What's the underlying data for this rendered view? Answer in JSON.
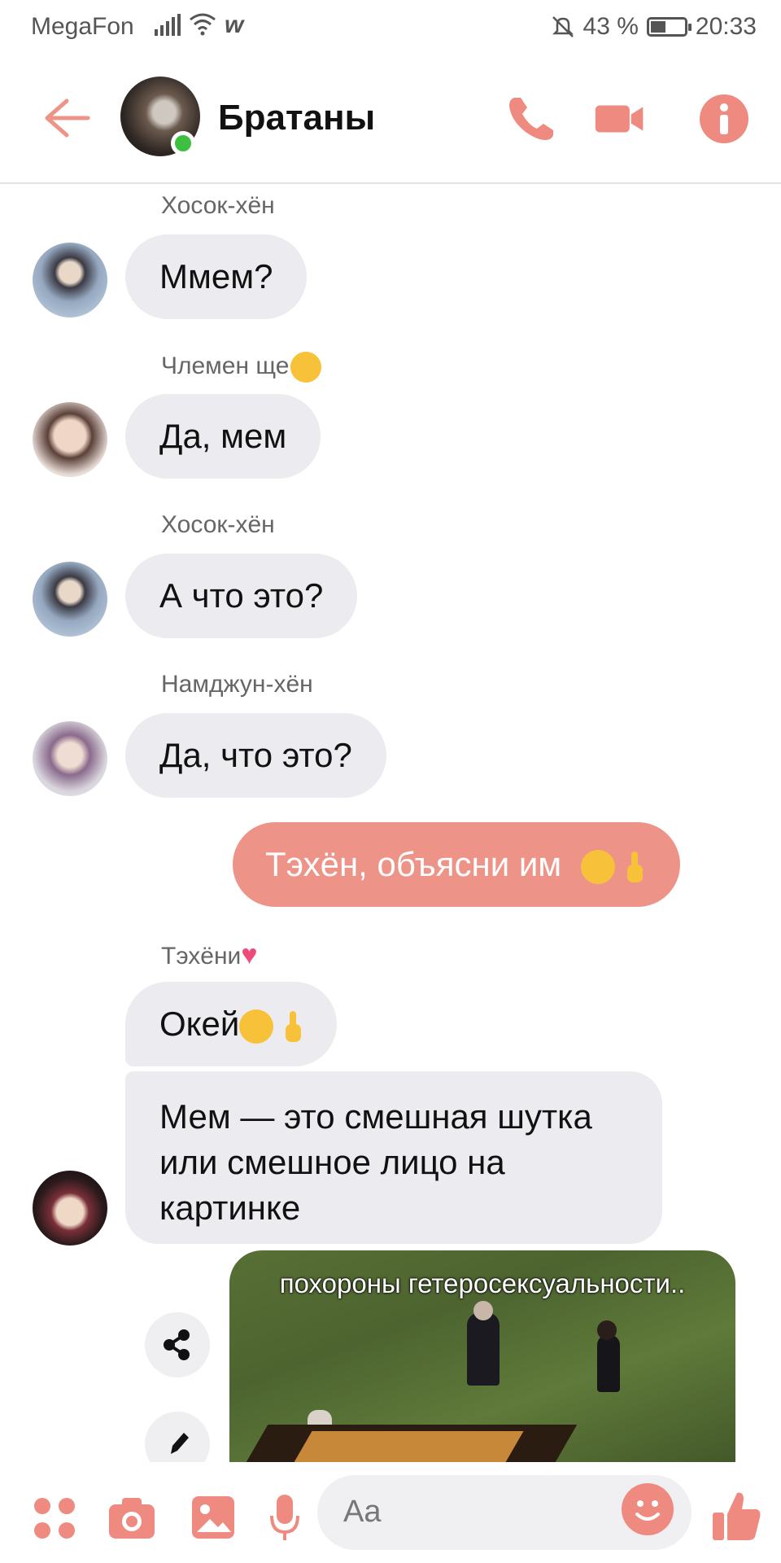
{
  "status": {
    "carrier": "MegaFon",
    "w_icon": "w",
    "battery": "43 %",
    "battery_level": 0.43,
    "time": "20:33"
  },
  "header": {
    "title": "Братаны",
    "online": true
  },
  "messages": [
    {
      "sender": "Хосок-хён",
      "text": "Ммем?"
    },
    {
      "sender": "Члемен ще",
      "text": "Да, мем"
    },
    {
      "sender": "Хосок-хён",
      "text": "А что это?"
    },
    {
      "sender": "Намджун-хён",
      "text": "Да, что это?"
    },
    {
      "outgoing": true,
      "text": "Тэхён, объясни им"
    },
    {
      "sender": "Тэхёни",
      "text": "Окей"
    },
    {
      "text": "Мем — это смешная шутка или смешное лицо на картинке"
    },
    {
      "image_caption": "похороны гетеросексуальности.."
    }
  ],
  "composer": {
    "placeholder": "Aa"
  },
  "colors": {
    "accent": "#ee9388",
    "bubble_in": "#ececf0",
    "online": "#3fbf3f"
  }
}
